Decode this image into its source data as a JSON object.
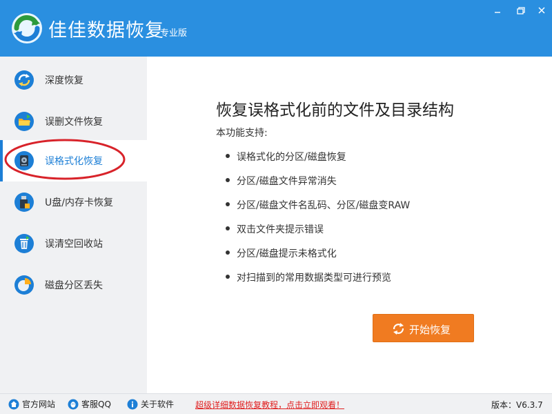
{
  "app": {
    "title": "佳佳数据恢复",
    "edition": "专业版"
  },
  "window_controls": [
    "minimize-icon",
    "maximize-icon",
    "close-icon"
  ],
  "sidebar": {
    "items": [
      {
        "label": "深度恢复",
        "icon": "deep-recovery-icon"
      },
      {
        "label": "误删文件恢复",
        "icon": "folder-icon"
      },
      {
        "label": "误格式化恢复",
        "icon": "disk-format-icon",
        "active": true
      },
      {
        "label": "U盘/内存卡恢复",
        "icon": "usb-card-icon"
      },
      {
        "label": "误清空回收站",
        "icon": "recycle-bin-icon"
      },
      {
        "label": "磁盘分区丢失",
        "icon": "pie-partition-icon"
      }
    ]
  },
  "main": {
    "title": "恢复误格式化前的文件及目录结构",
    "subtitle": "本功能支持:",
    "features": [
      "误格式化的分区/磁盘恢复",
      "分区/磁盘文件异常消失",
      "分区/磁盘文件名乱码、分区/磁盘变RAW",
      "双击文件夹提示错误",
      "分区/磁盘提示未格式化",
      "对扫描到的常用数据类型可进行预览"
    ],
    "start_button": "开始恢复"
  },
  "footer": {
    "website": "官方网站",
    "support": "客服QQ",
    "about": "关于软件",
    "promo": "超级详细数据恢复教程，点击立即观看！",
    "version": "版本：V6.3.7"
  },
  "colors": {
    "titlebar": "#2a8fe0",
    "accent": "#1d7fd6",
    "sidebar_bg": "#f0f1f3",
    "button": "#f07b21",
    "promo": "#e02020",
    "annotation": "#d8232a"
  }
}
